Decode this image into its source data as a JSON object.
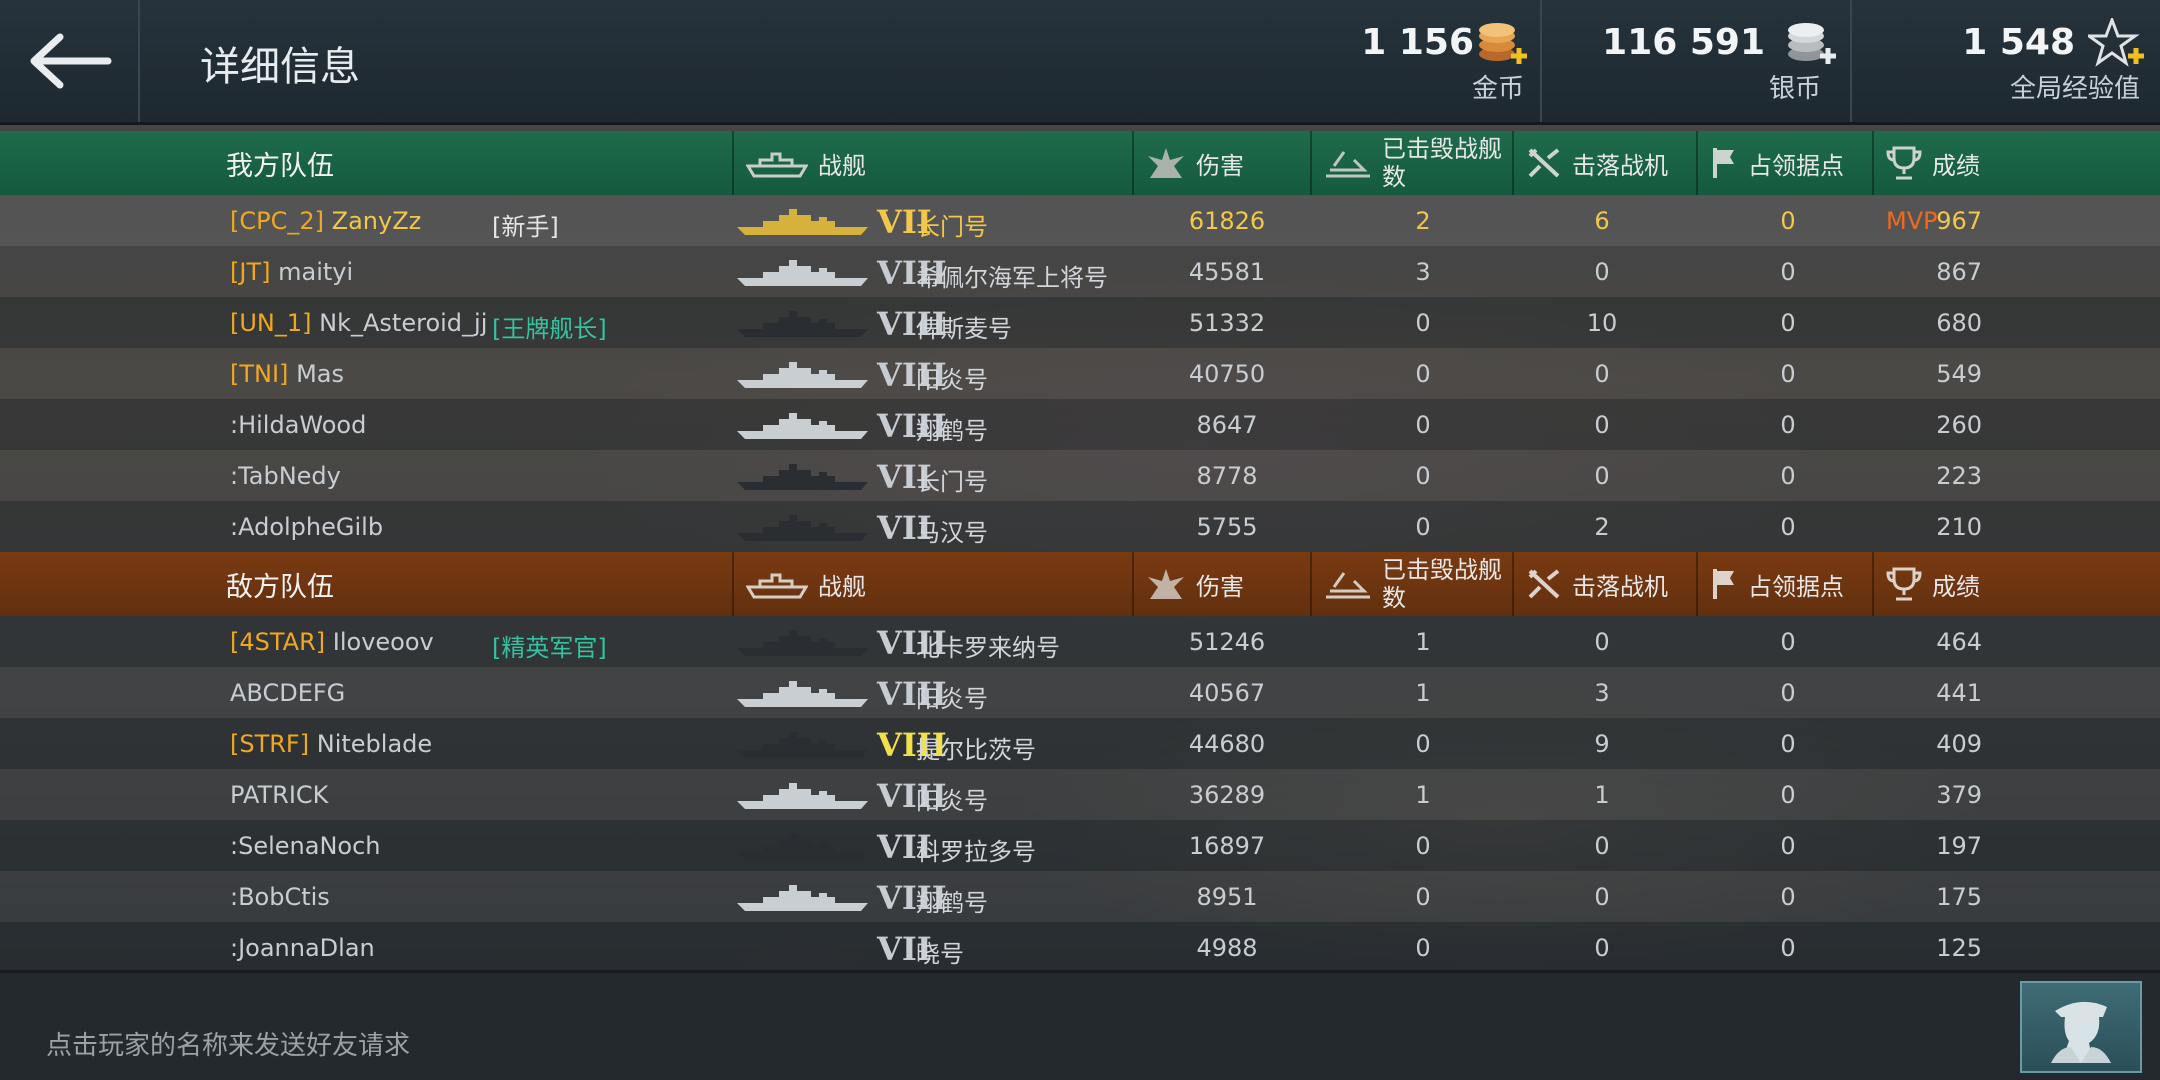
{
  "header": {
    "title": "详细信息",
    "gold": {
      "amount": "1 156",
      "label": "金币"
    },
    "silver": {
      "amount": "116 591",
      "label": "银币"
    },
    "xp": {
      "amount": "1 548",
      "label": "全局经验值"
    }
  },
  "columns": {
    "ship": "战舰",
    "damage": "伤害",
    "kills": "已击毁战舰数",
    "planes": "击落战机",
    "capture": "占领据点",
    "score": "成绩"
  },
  "ally": {
    "team_name": "我方队伍",
    "players": [
      {
        "clan": "[CPC_2]",
        "name": "ZanyZz",
        "badge": "[新手]",
        "tier": "VII",
        "ship": "长门号",
        "damage": "61826",
        "kills": "2",
        "planes": "6",
        "capture": "0",
        "mvp": "MVP",
        "score": "967"
      },
      {
        "clan": "[JT]",
        "name": "maityi",
        "badge": "",
        "tier": "VIII",
        "ship": "希佩尔海军上将号",
        "damage": "45581",
        "kills": "3",
        "planes": "0",
        "capture": "0",
        "mvp": "",
        "score": "867"
      },
      {
        "clan": "[UN_1]",
        "name": "Nk_Asteroid_jj",
        "badge": "[王牌舰长]",
        "tier": "VIII",
        "ship": "俾斯麦号",
        "damage": "51332",
        "kills": "0",
        "planes": "10",
        "capture": "0",
        "mvp": "",
        "score": "680"
      },
      {
        "clan": "[TNI]",
        "name": "Mas",
        "badge": "",
        "tier": "VIII",
        "ship": "阳炎号",
        "damage": "40750",
        "kills": "0",
        "planes": "0",
        "capture": "0",
        "mvp": "",
        "score": "549"
      },
      {
        "clan": "",
        "name": ":HildaWood",
        "badge": "",
        "tier": "VIII",
        "ship": "翔鹤号",
        "damage": "8647",
        "kills": "0",
        "planes": "0",
        "capture": "0",
        "mvp": "",
        "score": "260"
      },
      {
        "clan": "",
        "name": ":TabNedy",
        "badge": "",
        "tier": "VII",
        "ship": "长门号",
        "damage": "8778",
        "kills": "0",
        "planes": "0",
        "capture": "0",
        "mvp": "",
        "score": "223"
      },
      {
        "clan": "",
        "name": ":AdolpheGilb",
        "badge": "",
        "tier": "VII",
        "ship": "马汉号",
        "damage": "5755",
        "kills": "0",
        "planes": "2",
        "capture": "0",
        "mvp": "",
        "score": "210"
      }
    ]
  },
  "enemy": {
    "team_name": "敌方队伍",
    "players": [
      {
        "clan": "[4STAR]",
        "name": "Iloveoov",
        "badge": "[精英军官]",
        "tier": "VIII",
        "ship": "北卡罗来纳号",
        "damage": "51246",
        "kills": "1",
        "planes": "0",
        "capture": "0",
        "score": "464"
      },
      {
        "clan": "",
        "name": "ABCDEFG",
        "badge": "",
        "tier": "VIII",
        "ship": "阳炎号",
        "damage": "40567",
        "kills": "1",
        "planes": "3",
        "capture": "0",
        "score": "441"
      },
      {
        "clan": "[STRF]",
        "name": "Niteblade",
        "badge": "",
        "tier": "VIII",
        "ship": "提尔比茨号",
        "damage": "44680",
        "kills": "0",
        "planes": "9",
        "capture": "0",
        "score": "409"
      },
      {
        "clan": "",
        "name": "PATRICK",
        "badge": "",
        "tier": "VIII",
        "ship": "阳炎号",
        "damage": "36289",
        "kills": "1",
        "planes": "1",
        "capture": "0",
        "score": "379"
      },
      {
        "clan": "",
        "name": ":SelenaNoch",
        "badge": "",
        "tier": "VII",
        "ship": "科罗拉多号",
        "damage": "16897",
        "kills": "0",
        "planes": "0",
        "capture": "0",
        "score": "197"
      },
      {
        "clan": "",
        "name": ":BobCtis",
        "badge": "",
        "tier": "VIII",
        "ship": "翔鹤号",
        "damage": "8951",
        "kills": "0",
        "planes": "0",
        "capture": "0",
        "score": "175"
      },
      {
        "clan": "",
        "name": ":JoannaDlan",
        "badge": "",
        "tier": "VII",
        "ship": "晓号",
        "damage": "4988",
        "kills": "0",
        "planes": "0",
        "capture": "0",
        "score": "125"
      }
    ]
  },
  "footer": {
    "hint": "点击玩家的名称来发送好友请求"
  },
  "colors": {
    "ally_header": "#1f6b4c",
    "enemy_header": "#7a3a12",
    "clan_tag": "#f0a820",
    "highlight": "#f2c74a",
    "mvp": "#f06a1e",
    "badge": "#34c2a0"
  },
  "icons": [
    "back-arrow-icon",
    "gold-coin-icon",
    "silver-coin-icon",
    "xp-star-icon",
    "ship-icon",
    "damage-icon",
    "kills-icon",
    "planes-icon",
    "capture-flag-icon",
    "trophy-icon",
    "captain-icon"
  ]
}
